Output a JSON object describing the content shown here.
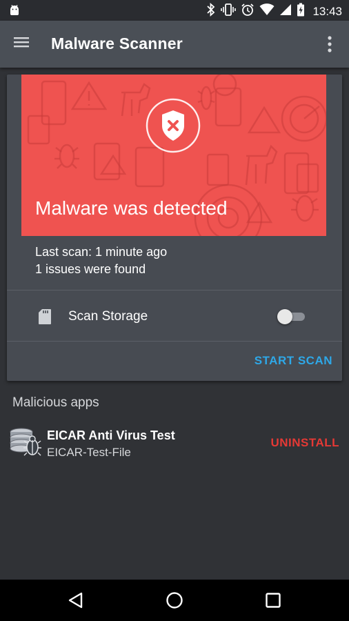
{
  "status_bar": {
    "time": "13:43",
    "icons": [
      "android-icon",
      "bluetooth-icon",
      "vibrate-icon",
      "alarm-icon",
      "wifi-icon",
      "signal-icon",
      "battery-icon"
    ]
  },
  "app_bar": {
    "title": "Malware Scanner",
    "icons": [
      "menu-icon",
      "more-vert-icon"
    ]
  },
  "scan_card": {
    "banner_headline": "Malware was detected",
    "banner_icon": "shield-x-icon",
    "banner_color": "#ef5350",
    "last_scan": "Last scan: 1 minute ago",
    "issues": "1 issues were found",
    "storage_label": "Scan Storage",
    "storage_toggle_on": false,
    "start_scan_label": "START SCAN"
  },
  "malicious_section": {
    "title": "Malicious apps",
    "apps": [
      {
        "name": "EICAR Anti Virus Test",
        "package": "EICAR-Test-File",
        "action_label": "UNINSTALL",
        "icon": "malware-bug-icon"
      }
    ]
  },
  "colors": {
    "accent": "#2ea8e8",
    "danger": "#e53935",
    "app_bar": "#4a4f56",
    "card": "#474b52",
    "background": "#303236"
  },
  "nav_bar": {
    "icons": [
      "back-icon",
      "home-icon",
      "recents-icon"
    ]
  }
}
